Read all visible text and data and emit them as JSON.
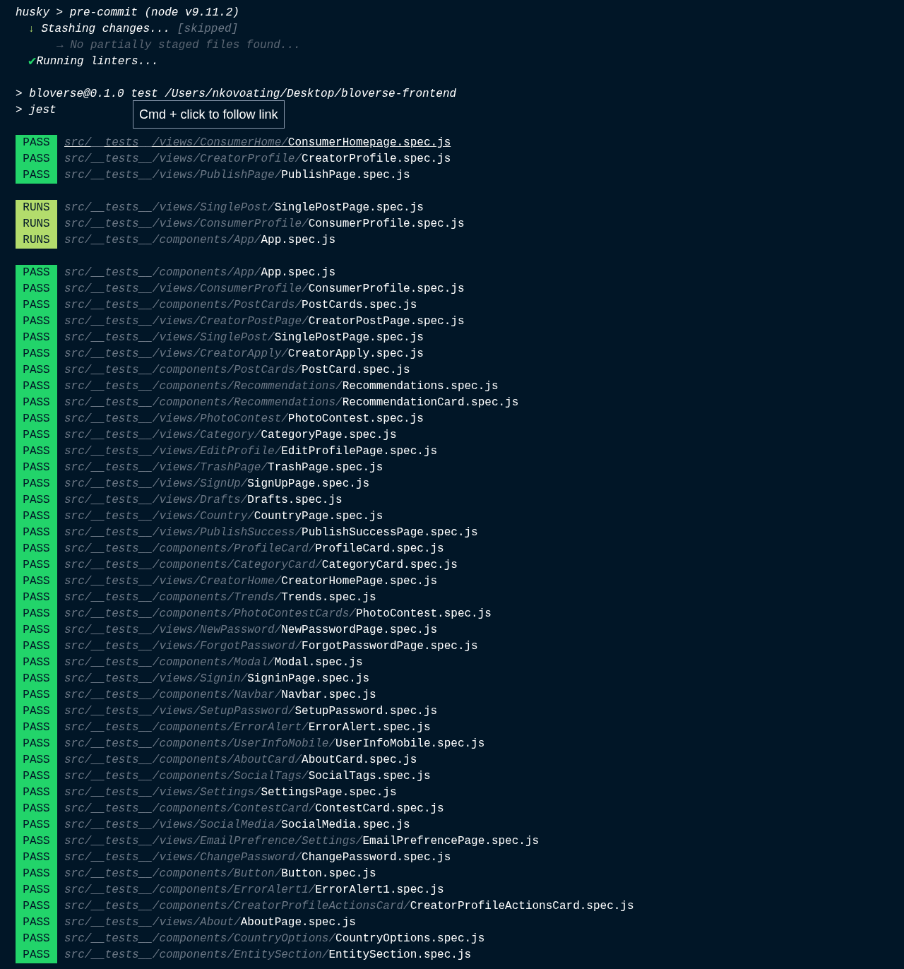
{
  "header": [
    {
      "kind": "title",
      "text": "husky > pre-commit (node v9.11.2)"
    },
    {
      "kind": "skipped",
      "icon": "↓",
      "text": "Stashing changes...",
      "note": "[skipped]"
    },
    {
      "kind": "sub",
      "text": "→ No partially staged files found..."
    },
    {
      "kind": "done",
      "icon": "✔",
      "text": "Running linters..."
    },
    {
      "kind": "blank"
    },
    {
      "kind": "command",
      "text": "> bloverse@0.1.0 test /Users/nkovoating/Desktop/bloverse-frontend"
    },
    {
      "kind": "command",
      "text": "> jest"
    }
  ],
  "tooltip": "Cmd + click to follow link",
  "groups": [
    {
      "rows": [
        {
          "status": "PASS",
          "kind": "pass",
          "dir": "src/__tests__/views/ConsumerHome/",
          "file": "ConsumerHomepage.spec.js",
          "hovered": true
        },
        {
          "status": "PASS",
          "kind": "pass",
          "dir": "src/__tests__/views/CreatorProfile/",
          "file": "CreatorProfile.spec.js",
          "hovered": false
        },
        {
          "status": "PASS",
          "kind": "pass",
          "dir": "src/__tests__/views/PublishPage/",
          "file": "PublishPage.spec.js",
          "hovered": false
        }
      ]
    },
    {
      "rows": [
        {
          "status": "RUNS",
          "kind": "runs",
          "dir": "src/__tests__/views/SinglePost/",
          "file": "SinglePostPage.spec.js",
          "hovered": false
        },
        {
          "status": "RUNS",
          "kind": "runs",
          "dir": "src/__tests__/views/ConsumerProfile/",
          "file": "ConsumerProfile.spec.js",
          "hovered": false
        },
        {
          "status": "RUNS",
          "kind": "runs",
          "dir": "src/__tests__/components/App/",
          "file": "App.spec.js",
          "hovered": false
        }
      ]
    },
    {
      "rows": [
        {
          "status": "PASS",
          "kind": "pass",
          "dir": "src/__tests__/components/App/",
          "file": "App.spec.js",
          "hovered": false
        },
        {
          "status": "PASS",
          "kind": "pass",
          "dir": "src/__tests__/views/ConsumerProfile/",
          "file": "ConsumerProfile.spec.js",
          "hovered": false
        },
        {
          "status": "PASS",
          "kind": "pass",
          "dir": "src/__tests__/components/PostCards/",
          "file": "PostCards.spec.js",
          "hovered": false
        },
        {
          "status": "PASS",
          "kind": "pass",
          "dir": "src/__tests__/views/CreatorPostPage/",
          "file": "CreatorPostPage.spec.js",
          "hovered": false
        },
        {
          "status": "PASS",
          "kind": "pass",
          "dir": "src/__tests__/views/SinglePost/",
          "file": "SinglePostPage.spec.js",
          "hovered": false
        },
        {
          "status": "PASS",
          "kind": "pass",
          "dir": "src/__tests__/views/CreatorApply/",
          "file": "CreatorApply.spec.js",
          "hovered": false
        },
        {
          "status": "PASS",
          "kind": "pass",
          "dir": "src/__tests__/components/PostCards/",
          "file": "PostCard.spec.js",
          "hovered": false
        },
        {
          "status": "PASS",
          "kind": "pass",
          "dir": "src/__tests__/components/Recommendations/",
          "file": "Recommendations.spec.js",
          "hovered": false
        },
        {
          "status": "PASS",
          "kind": "pass",
          "dir": "src/__tests__/components/Recommendations/",
          "file": "RecommendationCard.spec.js",
          "hovered": false
        },
        {
          "status": "PASS",
          "kind": "pass",
          "dir": "src/__tests__/views/PhotoContest/",
          "file": "PhotoContest.spec.js",
          "hovered": false
        },
        {
          "status": "PASS",
          "kind": "pass",
          "dir": "src/__tests__/views/Category/",
          "file": "CategoryPage.spec.js",
          "hovered": false
        },
        {
          "status": "PASS",
          "kind": "pass",
          "dir": "src/__tests__/views/EditProfile/",
          "file": "EditProfilePage.spec.js",
          "hovered": false
        },
        {
          "status": "PASS",
          "kind": "pass",
          "dir": "src/__tests__/views/TrashPage/",
          "file": "TrashPage.spec.js",
          "hovered": false
        },
        {
          "status": "PASS",
          "kind": "pass",
          "dir": "src/__tests__/views/SignUp/",
          "file": "SignUpPage.spec.js",
          "hovered": false
        },
        {
          "status": "PASS",
          "kind": "pass",
          "dir": "src/__tests__/views/Drafts/",
          "file": "Drafts.spec.js",
          "hovered": false
        },
        {
          "status": "PASS",
          "kind": "pass",
          "dir": "src/__tests__/views/Country/",
          "file": "CountryPage.spec.js",
          "hovered": false
        },
        {
          "status": "PASS",
          "kind": "pass",
          "dir": "src/__tests__/views/PublishSuccess/",
          "file": "PublishSuccessPage.spec.js",
          "hovered": false
        },
        {
          "status": "PASS",
          "kind": "pass",
          "dir": "src/__tests__/components/ProfileCard/",
          "file": "ProfileCard.spec.js",
          "hovered": false
        },
        {
          "status": "PASS",
          "kind": "pass",
          "dir": "src/__tests__/components/CategoryCard/",
          "file": "CategoryCard.spec.js",
          "hovered": false
        },
        {
          "status": "PASS",
          "kind": "pass",
          "dir": "src/__tests__/views/CreatorHome/",
          "file": "CreatorHomePage.spec.js",
          "hovered": false
        },
        {
          "status": "PASS",
          "kind": "pass",
          "dir": "src/__tests__/components/Trends/",
          "file": "Trends.spec.js",
          "hovered": false
        },
        {
          "status": "PASS",
          "kind": "pass",
          "dir": "src/__tests__/components/PhotoContestCards/",
          "file": "PhotoContest.spec.js",
          "hovered": false
        },
        {
          "status": "PASS",
          "kind": "pass",
          "dir": "src/__tests__/views/NewPassword/",
          "file": "NewPasswordPage.spec.js",
          "hovered": false
        },
        {
          "status": "PASS",
          "kind": "pass",
          "dir": "src/__tests__/views/ForgotPassword/",
          "file": "ForgotPasswordPage.spec.js",
          "hovered": false
        },
        {
          "status": "PASS",
          "kind": "pass",
          "dir": "src/__tests__/components/Modal/",
          "file": "Modal.spec.js",
          "hovered": false
        },
        {
          "status": "PASS",
          "kind": "pass",
          "dir": "src/__tests__/views/Signin/",
          "file": "SigninPage.spec.js",
          "hovered": false
        },
        {
          "status": "PASS",
          "kind": "pass",
          "dir": "src/__tests__/components/Navbar/",
          "file": "Navbar.spec.js",
          "hovered": false
        },
        {
          "status": "PASS",
          "kind": "pass",
          "dir": "src/__tests__/views/SetupPassword/",
          "file": "SetupPassword.spec.js",
          "hovered": false
        },
        {
          "status": "PASS",
          "kind": "pass",
          "dir": "src/__tests__/components/ErrorAlert/",
          "file": "ErrorAlert.spec.js",
          "hovered": false
        },
        {
          "status": "PASS",
          "kind": "pass",
          "dir": "src/__tests__/components/UserInfoMobile/",
          "file": "UserInfoMobile.spec.js",
          "hovered": false
        },
        {
          "status": "PASS",
          "kind": "pass",
          "dir": "src/__tests__/components/AboutCard/",
          "file": "AboutCard.spec.js",
          "hovered": false
        },
        {
          "status": "PASS",
          "kind": "pass",
          "dir": "src/__tests__/components/SocialTags/",
          "file": "SocialTags.spec.js",
          "hovered": false
        },
        {
          "status": "PASS",
          "kind": "pass",
          "dir": "src/__tests__/views/Settings/",
          "file": "SettingsPage.spec.js",
          "hovered": false
        },
        {
          "status": "PASS",
          "kind": "pass",
          "dir": "src/__tests__/components/ContestCard/",
          "file": "ContestCard.spec.js",
          "hovered": false
        },
        {
          "status": "PASS",
          "kind": "pass",
          "dir": "src/__tests__/views/SocialMedia/",
          "file": "SocialMedia.spec.js",
          "hovered": false
        },
        {
          "status": "PASS",
          "kind": "pass",
          "dir": "src/__tests__/views/EmailPrefrence/Settings/",
          "file": "EmailPrefrencePage.spec.js",
          "hovered": false
        },
        {
          "status": "PASS",
          "kind": "pass",
          "dir": "src/__tests__/views/ChangePassword/",
          "file": "ChangePassword.spec.js",
          "hovered": false
        },
        {
          "status": "PASS",
          "kind": "pass",
          "dir": "src/__tests__/components/Button/",
          "file": "Button.spec.js",
          "hovered": false
        },
        {
          "status": "PASS",
          "kind": "pass",
          "dir": "src/__tests__/components/ErrorAlert1/",
          "file": "ErrorAlert1.spec.js",
          "hovered": false
        },
        {
          "status": "PASS",
          "kind": "pass",
          "dir": "src/__tests__/components/CreatorProfileActionsCard/",
          "file": "CreatorProfileActionsCard.spec.js",
          "hovered": false
        },
        {
          "status": "PASS",
          "kind": "pass",
          "dir": "src/__tests__/views/About/",
          "file": "AboutPage.spec.js",
          "hovered": false
        },
        {
          "status": "PASS",
          "kind": "pass",
          "dir": "src/__tests__/components/CountryOptions/",
          "file": "CountryOptions.spec.js",
          "hovered": false
        },
        {
          "status": "PASS",
          "kind": "pass",
          "dir": "src/__tests__/components/EntitySection/",
          "file": "EntitySection.spec.js",
          "hovered": false
        }
      ]
    }
  ]
}
